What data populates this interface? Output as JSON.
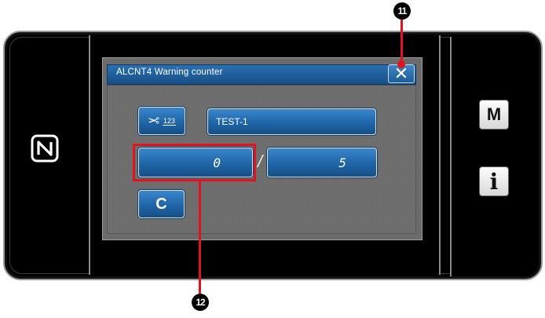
{
  "dialog": {
    "title": "ALCNT4  Warning counter",
    "close_label": "✕"
  },
  "thread_button": {
    "icon": "scissors-icon",
    "sub_label": "123"
  },
  "name_field": {
    "value": "TEST-1"
  },
  "counter": {
    "current_value": "0",
    "separator": "/",
    "limit_value": "5"
  },
  "clear_button": {
    "label": "C"
  },
  "side_panel": {
    "m_label": "M",
    "info_label": "i"
  },
  "annotations": {
    "marker_11": "11",
    "marker_12": "12",
    "color": "#e0141e"
  }
}
